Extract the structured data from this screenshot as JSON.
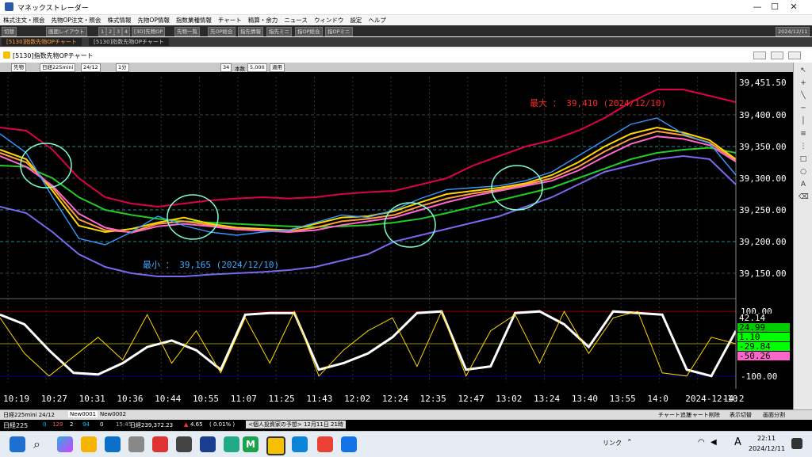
{
  "window": {
    "title": "マネックストレーダー",
    "min": "—",
    "max": "☐",
    "close": "✕"
  },
  "menu": [
    "株式注文・照会",
    "先物OP注文・照会",
    "株式情報",
    "先物OP情報",
    "指数業種情報",
    "チャート",
    "精算・余力",
    "ニュース",
    "ウィンドウ",
    "設定",
    "ヘルプ"
  ],
  "toolbar": {
    "cut": "切替",
    "layout": "画面レイアウト",
    "nums": [
      "1",
      "2",
      "3",
      "4"
    ],
    "items": [
      "[3D]先物OP",
      "先物一覧",
      "先OP総合",
      "指先情報",
      "指先ミニ",
      "指OP総合",
      "指OPミニ"
    ],
    "date": "2024/12/11"
  },
  "tabs": [
    "[5130]指数先物OPチャート",
    "[5130]指数先物OPチャート"
  ],
  "inner": {
    "title": "[5130]指数先物OPチャート"
  },
  "controls": {
    "kind": "先物",
    "name": "日経225mini",
    "month": "24/12",
    "period": "1分",
    "count": "34",
    "count_unit": "本数",
    "amount": "5,000",
    "apply": "適用"
  },
  "chart_data": [
    {
      "type": "line",
      "name": "price",
      "y_ticks": [
        "39,451.50",
        "39,400.00",
        "39,350.00",
        "39,300.00",
        "39,250.00",
        "39,200.00",
        "39,150.00"
      ],
      "ylim": [
        39120,
        39460
      ],
      "annotations": {
        "max": "最大 ： 39,410 (2024/12/10)",
        "min": "最小 ： 39,165 (2024/12/10)"
      },
      "x_ticks": [
        "10:19",
        "10:27",
        "10:31",
        "10:36",
        "10:44",
        "10:55",
        "11:07",
        "11:25",
        "11:43",
        "12:02",
        "12:24",
        "12:35",
        "12:47",
        "13:02",
        "13:24",
        "13:40",
        "13:55",
        "14:0",
        "2024-12-10",
        "14:2"
      ],
      "series": [
        {
          "color": "#e0004a",
          "values": [
            39380,
            39375,
            39345,
            39300,
            39270,
            39260,
            39255,
            39260,
            39265,
            39268,
            39270,
            39268,
            39270,
            39275,
            39278,
            39280,
            39290,
            39300,
            39320,
            39335,
            39350,
            39360,
            39375,
            39395,
            39420,
            39440,
            39440,
            39430,
            39420
          ]
        },
        {
          "color": "#7b68ee",
          "values": [
            39255,
            39245,
            39215,
            39180,
            39160,
            39150,
            39145,
            39145,
            39148,
            39150,
            39152,
            39155,
            39160,
            39170,
            39180,
            39200,
            39210,
            39220,
            39230,
            39240,
            39255,
            39270,
            39290,
            39310,
            39320,
            39330,
            39335,
            39330,
            39290
          ]
        },
        {
          "color": "#22cc22",
          "values": [
            39320,
            39318,
            39300,
            39270,
            39250,
            39242,
            39236,
            39232,
            39230,
            39228,
            39226,
            39224,
            39223,
            39224,
            39226,
            39230,
            39236,
            39245,
            39255,
            39265,
            39275,
            39285,
            39300,
            39315,
            39330,
            39340,
            39345,
            39348,
            39340
          ]
        },
        {
          "color": "#ffd700",
          "values": [
            39345,
            39330,
            39280,
            39225,
            39215,
            39220,
            39230,
            39238,
            39228,
            39222,
            39220,
            39218,
            39228,
            39238,
            39240,
            39248,
            39262,
            39275,
            39280,
            39285,
            39292,
            39305,
            39325,
            39350,
            39370,
            39380,
            39372,
            39360,
            39330
          ]
        },
        {
          "color": "#ff9f3f",
          "values": [
            39340,
            39325,
            39285,
            39235,
            39218,
            39215,
            39228,
            39232,
            39226,
            39220,
            39218,
            39216,
            39222,
            39232,
            39236,
            39242,
            39256,
            39268,
            39276,
            39282,
            39290,
            39300,
            39318,
            39342,
            39362,
            39374,
            39368,
            39356,
            39328
          ]
        },
        {
          "color": "#ff66cc",
          "values": [
            39335,
            39318,
            39288,
            39244,
            39222,
            39214,
            39224,
            39228,
            39224,
            39219,
            39217,
            39215,
            39218,
            39226,
            39232,
            39238,
            39250,
            39262,
            39272,
            39280,
            39288,
            39296,
            39312,
            39334,
            39354,
            39366,
            39362,
            39352,
            39326
          ]
        },
        {
          "color": "#3399ff",
          "values": [
            39370,
            39340,
            39270,
            39205,
            39195,
            39215,
            39240,
            39225,
            39215,
            39210,
            39215,
            39218,
            39230,
            39242,
            39238,
            39250,
            39268,
            39282,
            39285,
            39288,
            39296,
            39310,
            39335,
            39360,
            39385,
            39395,
            39370,
            39355,
            39305
          ]
        }
      ]
    },
    {
      "type": "line",
      "name": "oscillator",
      "y_ticks": [
        "100.00",
        "-100.00"
      ],
      "ylim": [
        -120,
        120
      ],
      "readouts": [
        "42.14",
        "24.99",
        "1.10",
        "-29.84",
        "-50.26"
      ],
      "series": [
        {
          "color": "#ffffff",
          "values": [
            90,
            60,
            -20,
            -90,
            -95,
            -60,
            -10,
            10,
            -20,
            -80,
            90,
            95,
            95,
            -80,
            -60,
            -30,
            20,
            95,
            100,
            -80,
            -70,
            95,
            100,
            60,
            -10,
            100,
            95,
            90,
            -80,
            -100,
            40
          ]
        },
        {
          "color": "#ffd700",
          "values": [
            80,
            -30,
            -100,
            -40,
            20,
            -50,
            90,
            -60,
            40,
            -90,
            80,
            -60,
            100,
            -100,
            -20,
            40,
            80,
            -70,
            100,
            -100,
            40,
            90,
            -60,
            100,
            -30,
            80,
            100,
            -90,
            -100,
            20,
            0
          ]
        }
      ]
    }
  ],
  "bottombar": {
    "sym": "日経225mini 24/12",
    "tabs": [
      "New0001",
      "New0002"
    ],
    "right": [
      "チャート追加",
      "チャート削除",
      "表示切替",
      "画面分割"
    ]
  },
  "statusbar": {
    "sym": "日経225",
    "vals": [
      "0",
      "129",
      "2",
      "94",
      "0"
    ],
    "time": "15:45",
    "index": "日経239,372.23",
    "chg": "4.65",
    "pct": "( 0.01% )",
    "news": "<個人投資家の予想> 12月11日 21時"
  },
  "taskbar": {
    "time": "22:11",
    "date": "2024/12/11",
    "tray": "リンク",
    "ime": "A"
  }
}
